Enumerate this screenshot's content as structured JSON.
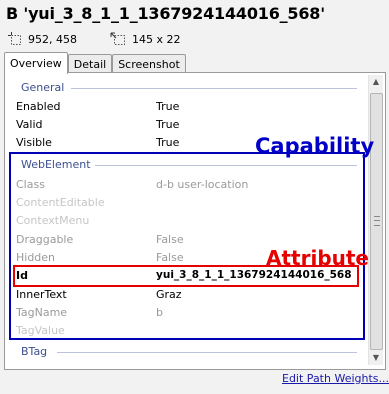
{
  "title": "B 'yui_3_8_1_1_1367924144016_568'",
  "info": {
    "position": "952, 458",
    "size": "145 x 22"
  },
  "tabs": [
    "Overview",
    "Detail",
    "Screenshot"
  ],
  "groups": {
    "general": {
      "name": "General",
      "rows": [
        {
          "key": "Enabled",
          "value": "True"
        },
        {
          "key": "Valid",
          "value": "True"
        },
        {
          "key": "Visible",
          "value": "True"
        }
      ]
    },
    "webelement": {
      "name": "WebElement",
      "rows": [
        {
          "key": "Class",
          "value": "d-b user-location"
        },
        {
          "key": "ContentEditable",
          "value": ""
        },
        {
          "key": "ContextMenu",
          "value": ""
        },
        {
          "key": "Draggable",
          "value": "False"
        },
        {
          "key": "Hidden",
          "value": "False"
        },
        {
          "key": "Id",
          "value": "yui_3_8_1_1_1367924144016_568"
        },
        {
          "key": "InnerText",
          "value": "Graz"
        },
        {
          "key": "TagName",
          "value": "b"
        },
        {
          "key": "TagValue",
          "value": ""
        }
      ]
    },
    "btag": {
      "name": "BTag"
    }
  },
  "annotations": {
    "capability": "Capability",
    "attribute": "Attribute"
  },
  "link": "Edit Path Weights...",
  "colors": {
    "capability": "#0000c8",
    "attribute": "#e60000",
    "link": "#1a1aa8"
  }
}
